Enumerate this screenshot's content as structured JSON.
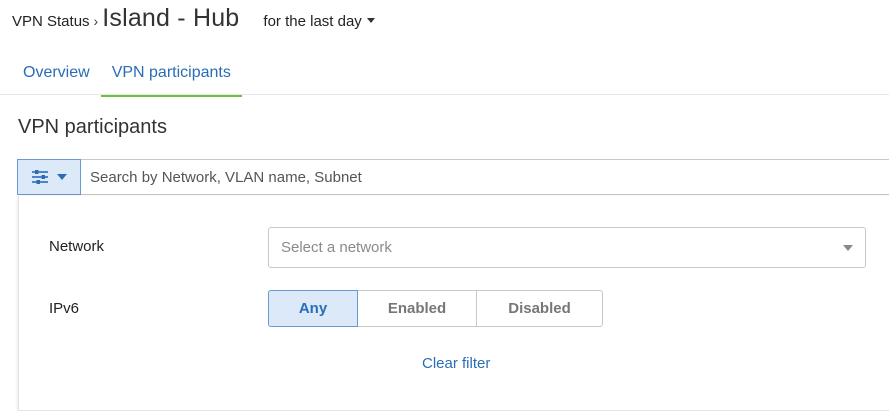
{
  "header": {
    "breadcrumb": "VPN Status",
    "separator": "›",
    "title": "Island - Hub",
    "time_range": "for the last day"
  },
  "tabs": [
    {
      "label": "Overview",
      "active": false
    },
    {
      "label": "VPN participants",
      "active": true
    }
  ],
  "section_title": "VPN participants",
  "search": {
    "placeholder": "Search by Network, VLAN name, Subnet",
    "value": "",
    "filter_icon": "sliders-icon"
  },
  "filters": {
    "network": {
      "label": "Network",
      "placeholder": "Select a network"
    },
    "ipv6": {
      "label": "IPv6",
      "options": [
        "Any",
        "Enabled",
        "Disabled"
      ],
      "selected": "Any"
    },
    "clear_label": "Clear filter"
  },
  "colors": {
    "link": "#2a6db5",
    "active_tab_underline": "#6fbe44",
    "selected_bg": "#dce9f8"
  }
}
